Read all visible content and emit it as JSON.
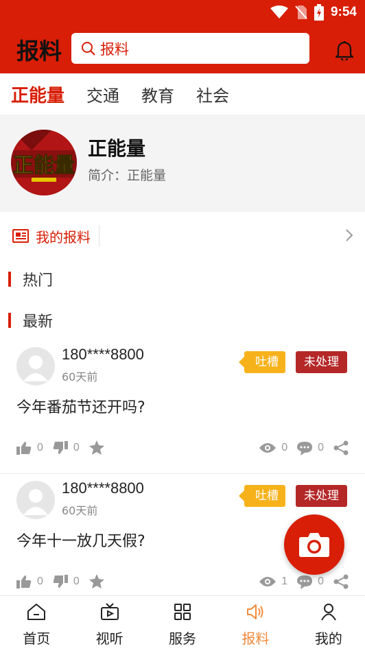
{
  "status_bar": {
    "time": "9:54"
  },
  "header": {
    "title": "报料",
    "search_placeholder": "报料"
  },
  "tabs": [
    {
      "label": "正能量",
      "active": true
    },
    {
      "label": "交通",
      "active": false
    },
    {
      "label": "教育",
      "active": false
    },
    {
      "label": "社会",
      "active": false
    }
  ],
  "channel": {
    "logo_text": "正能量",
    "name": "正能量",
    "description": "简介：正能量"
  },
  "my_report": {
    "label": "我的报料"
  },
  "sections": {
    "hot": "热门",
    "latest": "最新"
  },
  "posts": [
    {
      "author": "180****8800",
      "time": "60天前",
      "tag": "吐槽",
      "status": "未处理",
      "content": "今年番茄节还开吗?",
      "likes": "0",
      "dislikes": "0",
      "views": "0",
      "comments": "0"
    },
    {
      "author": "180****8800",
      "time": "60天前",
      "tag": "吐槽",
      "status": "未处理",
      "content": "今年十一放几天假?",
      "likes": "0",
      "dislikes": "0",
      "views": "1",
      "comments": "0"
    }
  ],
  "bottom_nav": [
    {
      "label": "首页",
      "icon": "home-icon",
      "active": false
    },
    {
      "label": "视听",
      "icon": "tv-icon",
      "active": false
    },
    {
      "label": "服务",
      "icon": "grid-icon",
      "active": false
    },
    {
      "label": "报料",
      "icon": "speaker-icon",
      "active": true
    },
    {
      "label": "我的",
      "icon": "user-icon",
      "active": false
    }
  ],
  "colors": {
    "brand_red": "#d81e06",
    "tag_yellow": "#f7b21b",
    "status_red": "#b52828",
    "nav_active": "#f08a3c"
  }
}
